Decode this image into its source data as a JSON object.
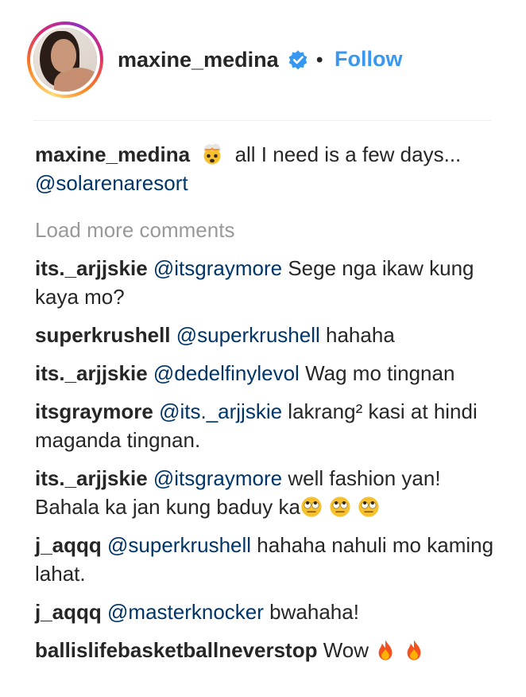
{
  "header": {
    "username": "maxine_medina",
    "separator": "•",
    "follow_label": "Follow",
    "verified_icon": "verified-badge-icon",
    "accent": "#3897f0"
  },
  "caption": {
    "user": "maxine_medina",
    "emoji": "exploding-head-emoji",
    "text": "all I need is a few days...",
    "mention": "@solarenaresort"
  },
  "load_more_label": "Load more comments",
  "comments": [
    {
      "user": "its._arjjskie",
      "mention": "@itsgraymore",
      "text": "Sege nga ikaw kung kaya mo?"
    },
    {
      "user": "superkrushell",
      "mention": "@superkrushell",
      "text": "hahaha"
    },
    {
      "user": "its._arjjskie",
      "mention": "@dedelfinylevol",
      "text": "Wag mo tingnan"
    },
    {
      "user": "itsgraymore",
      "mention": "@its._arjjskie",
      "text": "lakrang² kasi at hindi maganda tingnan."
    },
    {
      "user": "its._arjjskie",
      "mention": "@itsgraymore",
      "text": "well fashion yan! Bahala ka jan kung baduy ka",
      "emojis": [
        "face-with-rolling-eyes",
        "face-with-rolling-eyes",
        "face-with-rolling-eyes"
      ]
    },
    {
      "user": "j_aqqq",
      "mention": "@superkrushell",
      "text": "hahaha nahuli mo kaming lahat."
    },
    {
      "user": "j_aqqq",
      "mention": "@masterknocker",
      "text": "bwahaha!"
    },
    {
      "user": "ballislifebasketballneverstop",
      "mention": "",
      "text": "Wow",
      "emojis": [
        "fire",
        "fire"
      ]
    }
  ],
  "colors": {
    "mention": "#003569",
    "muted": "#999999",
    "text": "#262626"
  }
}
